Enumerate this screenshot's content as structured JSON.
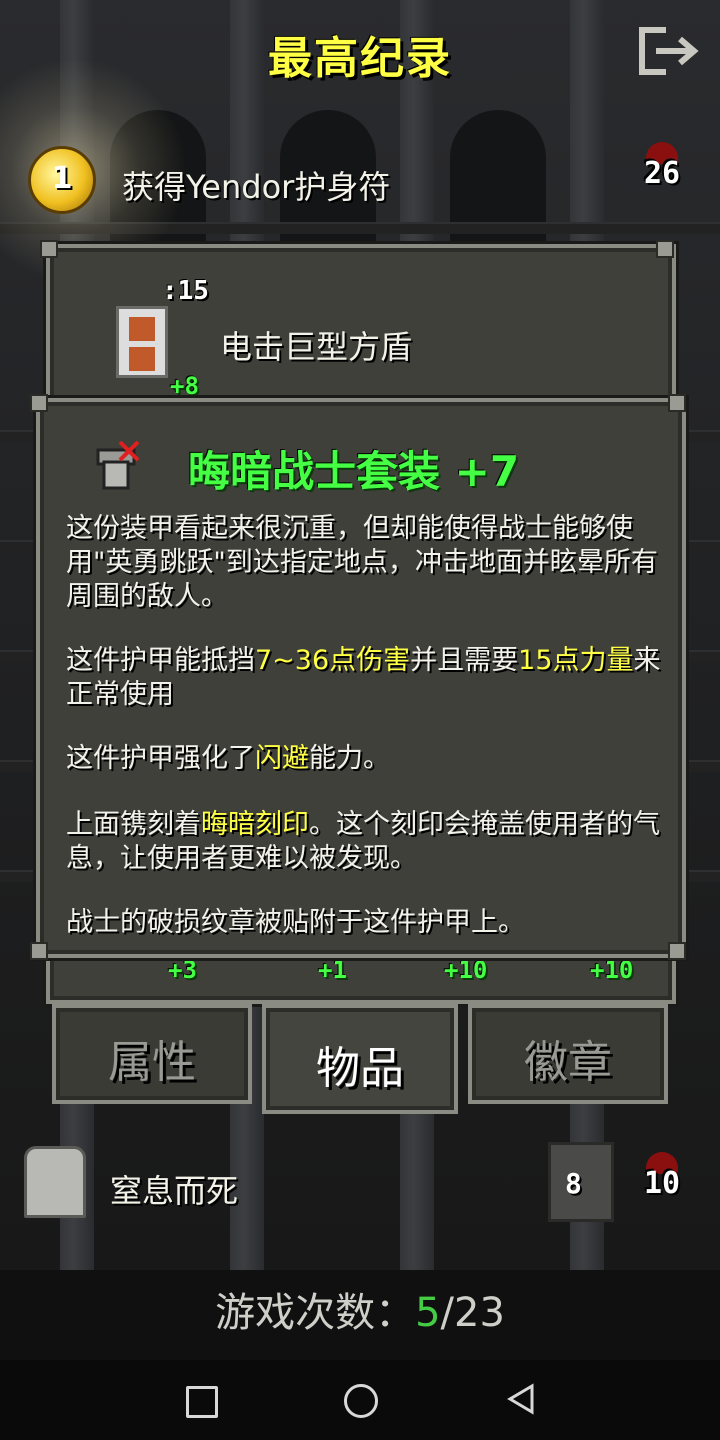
{
  "header": {
    "title": "最高纪录"
  },
  "top_record": {
    "rank": "1",
    "label": "获得Yendor护身符",
    "depth": "26"
  },
  "item_panel": {
    "item_name": "电击巨型方盾",
    "quantity": ":15",
    "upgrade": "+8"
  },
  "item_detail": {
    "title": "晦暗战士套装 +7",
    "para1": "这份装甲看起来很沉重，但却能使得战士能够使用\"英勇跳跃\"到达指定地点，冲击地面并眩晕所有周围的敌人。",
    "para2": {
      "pre": "这件护甲能抵挡",
      "dmg": "7~36点伤害",
      "mid": "并且需要",
      "str": "15点力量",
      "post": "来正常使用"
    },
    "para3": {
      "pre": "这件护甲强化了",
      "hl": "闪避",
      "post": "能力。"
    },
    "para4": {
      "pre": "上面镌刻着",
      "hl": "晦暗刻印",
      "post": "。这个刻印会掩盖使用者的气息，让使用者更难以被发现。"
    },
    "para5": "战士的破损纹章被贴附于这件护甲上。"
  },
  "hidden_slots": [
    "+3",
    "+1",
    "+10",
    "+10"
  ],
  "tabs": [
    {
      "label": "属性",
      "active": false
    },
    {
      "label": "物品",
      "active": true
    },
    {
      "label": "徽章",
      "active": false
    }
  ],
  "bottom_record": {
    "label": "窒息而死",
    "class_level": "8",
    "depth": "10"
  },
  "games_played": {
    "label": "游戏次数：",
    "current": "5",
    "sep": "/",
    "total": "23"
  },
  "colors": {
    "title_yellow": "#ffff44",
    "upgrade_green": "#44ff44",
    "panel_bg": "#3f403a",
    "panel_border": "#8a8c84"
  },
  "icons": {
    "exit": "exit-icon",
    "medal": "amulet-medal-icon",
    "depth": "depth-icon",
    "shield": "shield-icon",
    "armor": "armor-icon",
    "tomb": "tombstone-icon",
    "class": "warrior-class-icon"
  }
}
